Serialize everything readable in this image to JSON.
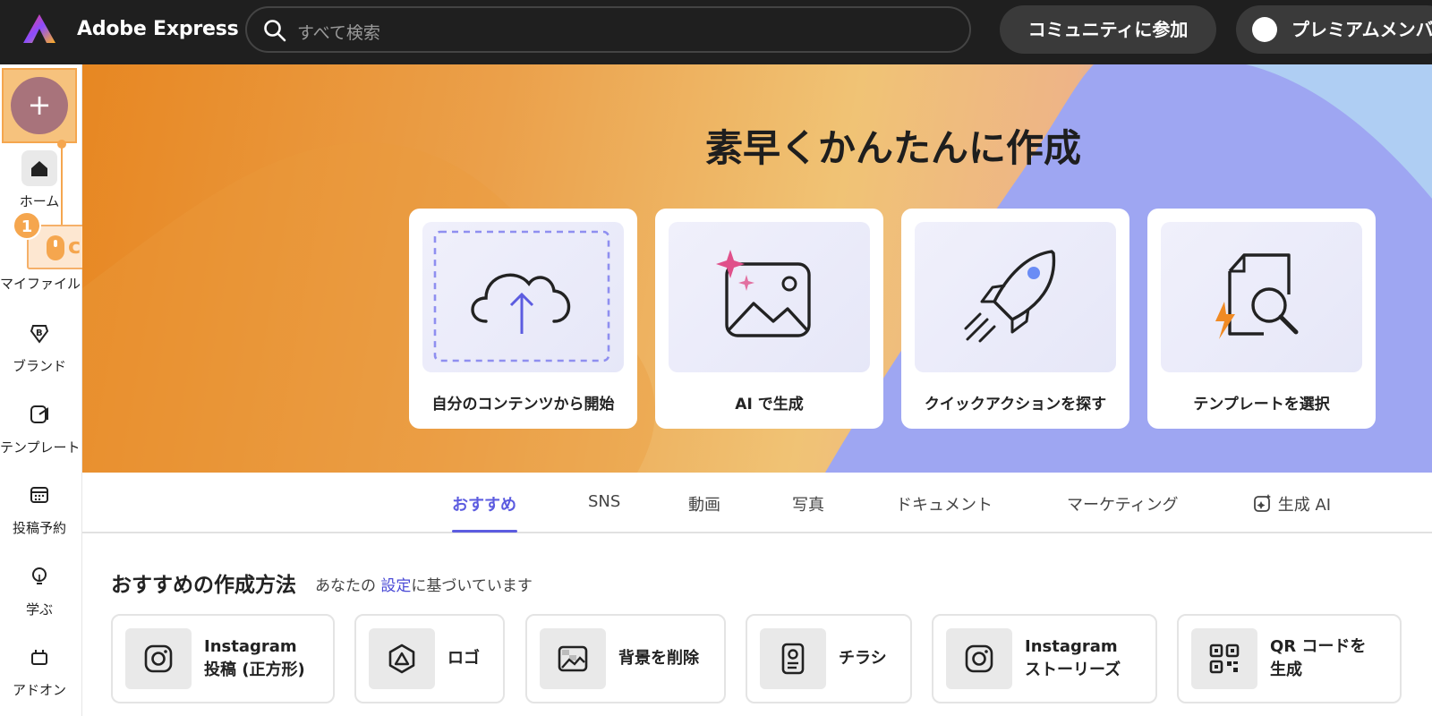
{
  "app": {
    "title": "Adobe Express"
  },
  "search": {
    "placeholder": "すべて検索"
  },
  "header": {
    "community_label": "コミュニティに参加",
    "premium_label": "プレミアムメンバー"
  },
  "rail": {
    "items": [
      {
        "label": "ホーム",
        "icon": "home-icon"
      },
      {
        "label": "マイファイル",
        "icon": "folder-icon"
      },
      {
        "label": "ブランド",
        "icon": "brand-icon"
      },
      {
        "label": "テンプレート",
        "icon": "template-icon"
      },
      {
        "label": "投稿予約",
        "icon": "calendar-icon"
      },
      {
        "label": "学ぶ",
        "icon": "lightbulb-icon"
      },
      {
        "label": "アドオン",
        "icon": "addon-icon"
      }
    ]
  },
  "annotation": {
    "step": "1",
    "action": "click"
  },
  "hero": {
    "title": "素早くかんたんに作成",
    "cards": [
      {
        "label": "自分のコンテンツから開始",
        "icon": "cloud-upload-icon"
      },
      {
        "label": "AI で生成",
        "icon": "ai-image-icon"
      },
      {
        "label": "クイックアクションを探す",
        "icon": "rocket-icon"
      },
      {
        "label": "テンプレートを選択",
        "icon": "template-search-icon"
      }
    ]
  },
  "tabs": [
    {
      "label": "おすすめ",
      "active": true
    },
    {
      "label": "SNS"
    },
    {
      "label": "動画"
    },
    {
      "label": "写真"
    },
    {
      "label": "ドキュメント"
    },
    {
      "label": "マーケティング"
    },
    {
      "label": "生成 AI",
      "icon": "sparkle-icon"
    }
  ],
  "section": {
    "title": "おすすめの作成方法",
    "subtitle_pre": "あなたの",
    "subtitle_link": "設定",
    "subtitle_post": "に基づいています"
  },
  "quick_items": [
    {
      "label": "Instagram\n投稿 (正方形)",
      "icon": "instagram-icon"
    },
    {
      "label": "ロゴ",
      "icon": "logo-icon"
    },
    {
      "label": "背景を削除",
      "icon": "remove-background-icon"
    },
    {
      "label": "チラシ",
      "icon": "flyer-icon"
    },
    {
      "label": "Instagram\nストーリーズ",
      "icon": "instagram-icon"
    },
    {
      "label": "QR コードを\n生成",
      "icon": "qr-code-icon"
    }
  ],
  "colors": {
    "accent": "#5c5ce0",
    "annotation": "#f5a64e",
    "topbar": "#1f1f1f"
  }
}
